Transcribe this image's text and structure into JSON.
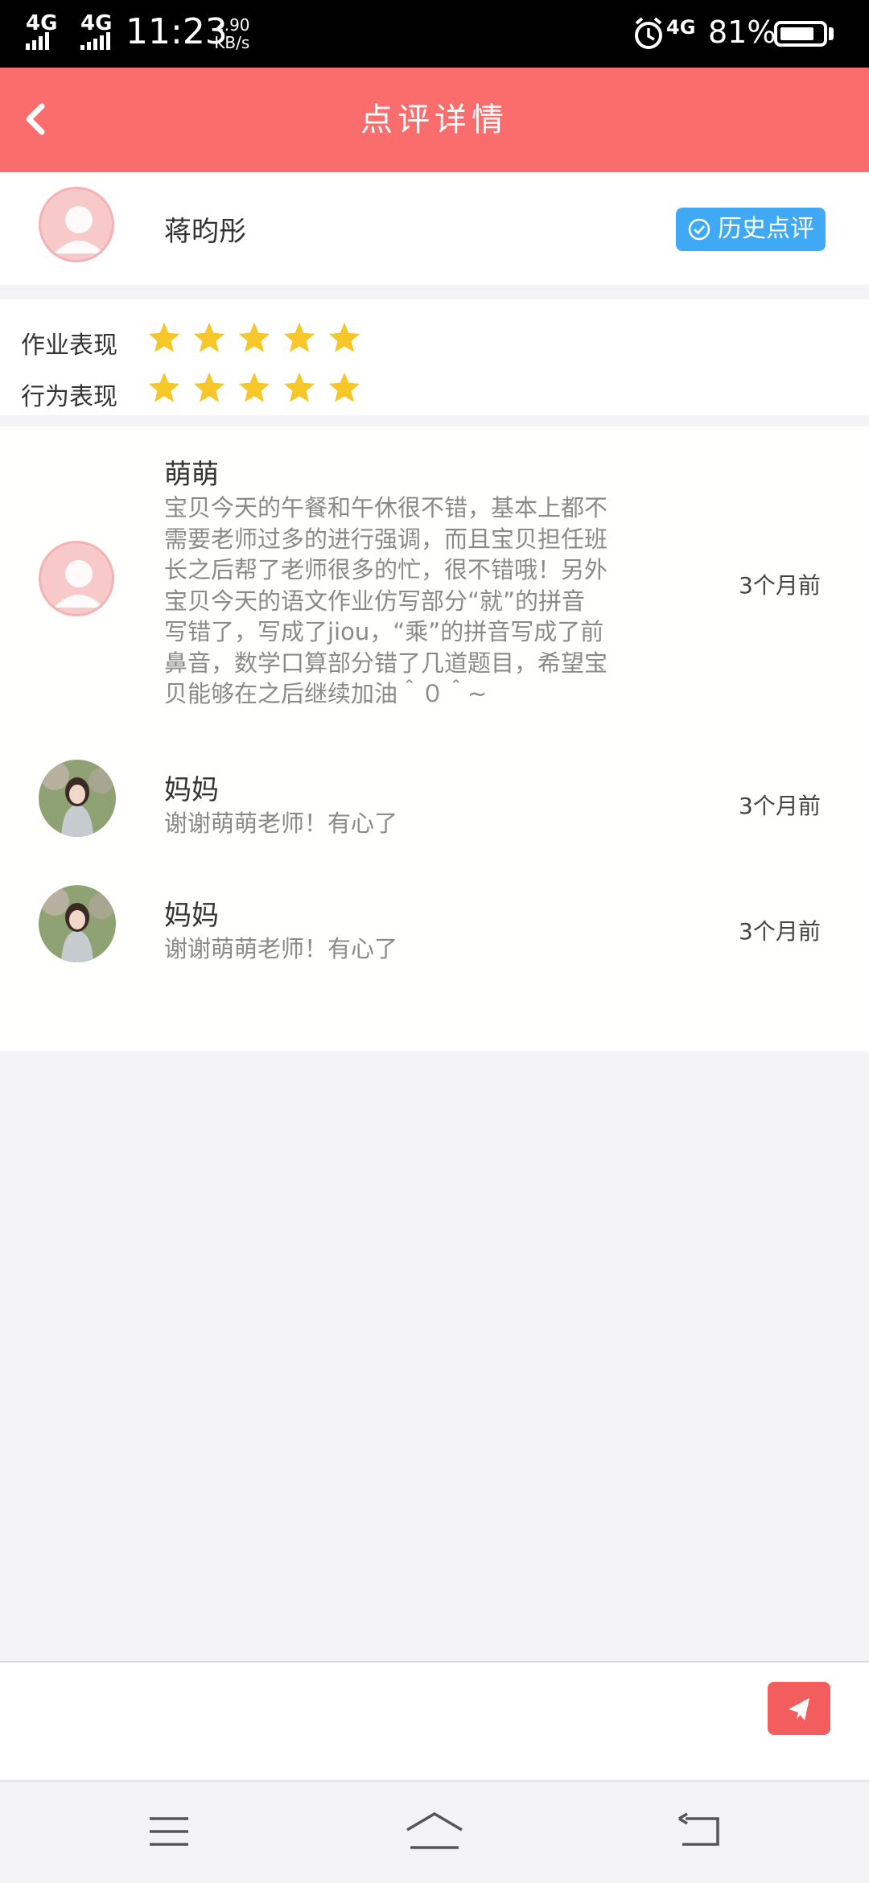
{
  "status_bar": {
    "signal1": "4G",
    "signal2": "4G",
    "time": "11:23",
    "speed_value": "2.90",
    "speed_unit": "KB/s",
    "network": "4G",
    "battery_text": "81%",
    "battery_level": 0.81
  },
  "header": {
    "title": "点评详情",
    "back_icon": "chevron-left-icon"
  },
  "student": {
    "name": "蒋昀彤",
    "history_button_label": "历史点评",
    "history_icon": "check-circle-icon"
  },
  "ratings": [
    {
      "label": "作业表现",
      "stars": 5
    },
    {
      "label": "行为表现",
      "stars": 5
    }
  ],
  "comments": [
    {
      "name": "萌萌",
      "lines": [
        "宝贝今天的午餐和午休很不错，基本上都不",
        "需要老师过多的进行强调，而且宝贝担任班",
        "长之后帮了老师很多的忙，很不错哦！另外",
        "宝贝今天的语文作业仿写部分“就”的拼音",
        "写错了，写成了jiou，“乘”的拼音写成了前",
        "鼻音，数学口算部分错了几道题目，希望宝",
        "贝能够在之后继续加油＾０＾~"
      ],
      "time": "3个月前",
      "avatar": "default-avatar"
    },
    {
      "name": "妈妈",
      "text": "谢谢萌萌老师！有心了",
      "time": "3个月前",
      "avatar": "photo-avatar"
    },
    {
      "name": "妈妈",
      "text": "谢谢萌萌老师！有心了",
      "time": "3个月前",
      "avatar": "photo-avatar"
    }
  ],
  "send_icon": "send-icon",
  "nav": {
    "menu_icon": "menu-icon",
    "home_icon": "home-icon",
    "back_icon": "back-icon"
  },
  "colors": {
    "header": "#fb6d6d",
    "history_button": "#3fa9f5",
    "star": "#f7c629",
    "send_button": "#f45d5d"
  }
}
